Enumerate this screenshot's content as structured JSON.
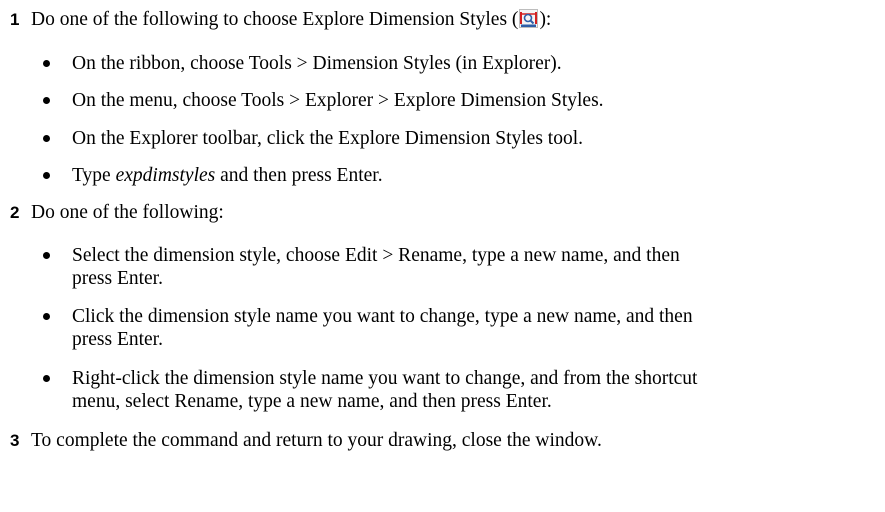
{
  "steps": [
    {
      "number": "1",
      "text_before": "Do one of the following to choose Explore Dimension Styles (",
      "icon": "explore-dimension-styles-icon",
      "text_after": "):",
      "bullets": [
        {
          "text": "On the ribbon, choose Tools > Dimension Styles (in Explorer)."
        },
        {
          "text": "On the menu, choose Tools > Explorer > Explore Dimension Styles."
        },
        {
          "text": "On the Explorer toolbar, click the Explore Dimension Styles tool."
        },
        {
          "prefix": "Type ",
          "emphasis": "expdimstyles",
          "suffix": " and then press Enter."
        }
      ]
    },
    {
      "number": "2",
      "text": "Do one of the following:",
      "bullets": [
        {
          "line1": "Select the dimension style, choose Edit > Rename, type a new name, and then",
          "line2": "press Enter."
        },
        {
          "line1": "Click the dimension style name you want to change, type a new name, and then",
          "line2": "press Enter."
        },
        {
          "line1": "Right-click the dimension style name you want to change, and from the shortcut",
          "line2": "menu, select Rename, type a new name, and then press Enter."
        }
      ]
    },
    {
      "number": "3",
      "text": "To complete the command and return to your drawing, close the window."
    }
  ],
  "colors": {
    "icon_red": "#d32020",
    "icon_blue": "#2f5fa8"
  }
}
